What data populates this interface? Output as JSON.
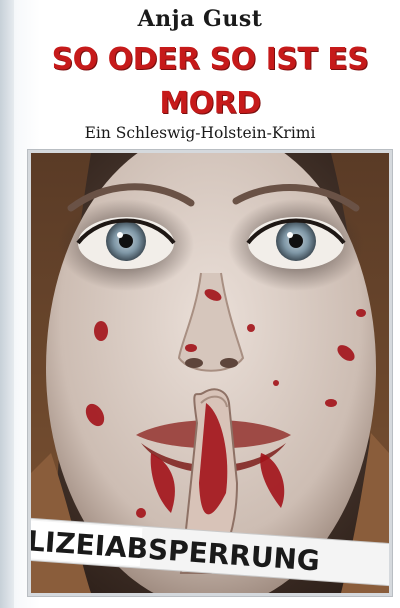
{
  "book": {
    "author": "Anja Gust",
    "title_line1": "SO ODER SO IST ES",
    "title_line2": "MORD",
    "subtitle": "Ein Schleswig-Holstein-Krimi",
    "tape_text": "LIZEIABSPERRUNG"
  },
  "colors": {
    "title": "#c61a1a",
    "tape_red": "#d6262c",
    "tape_white": "#f4f4f4",
    "blood": "#a3131a"
  },
  "icons": {
    "cover_art": "woman-face-shush-illustration"
  }
}
